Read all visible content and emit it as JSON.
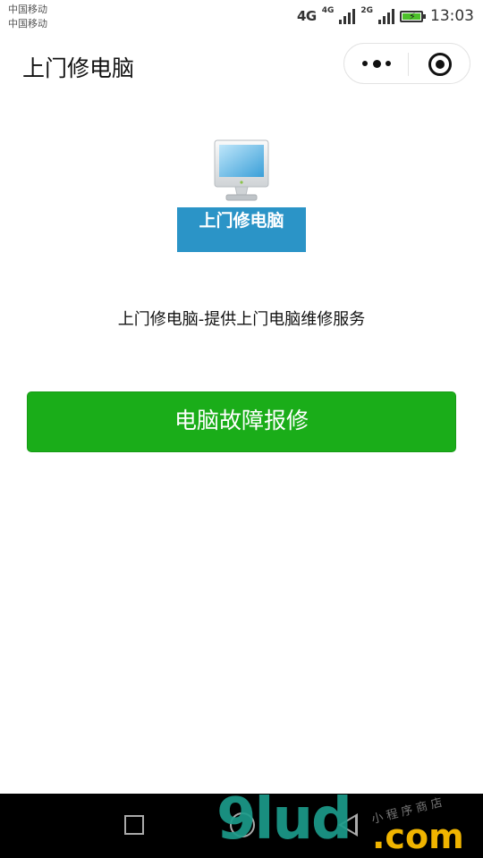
{
  "status_bar": {
    "carrier_1": "中国移动",
    "carrier_2": "中国移动",
    "network_1": "4G",
    "network_2": "4G",
    "network_3": "2G",
    "time": "13:03"
  },
  "nav_bar": {
    "title": "上门修电脑",
    "more_icon": "more-dots-icon",
    "close_icon": "target-circle-icon"
  },
  "main": {
    "logo_icon": "computer-monitor-icon",
    "logo_text": "上门修电脑",
    "description": "上门修电脑-提供上门电脑维修服务",
    "repair_button_label": "电脑故障报修"
  },
  "colors": {
    "button_green": "#1aad19",
    "logo_blue": "#2b94c7",
    "watermark_teal": "#1c9b8a",
    "watermark_yellow": "#f0b400"
  },
  "watermark": {
    "main": "9lud",
    "domain": ".com",
    "small": "小程序商店"
  }
}
